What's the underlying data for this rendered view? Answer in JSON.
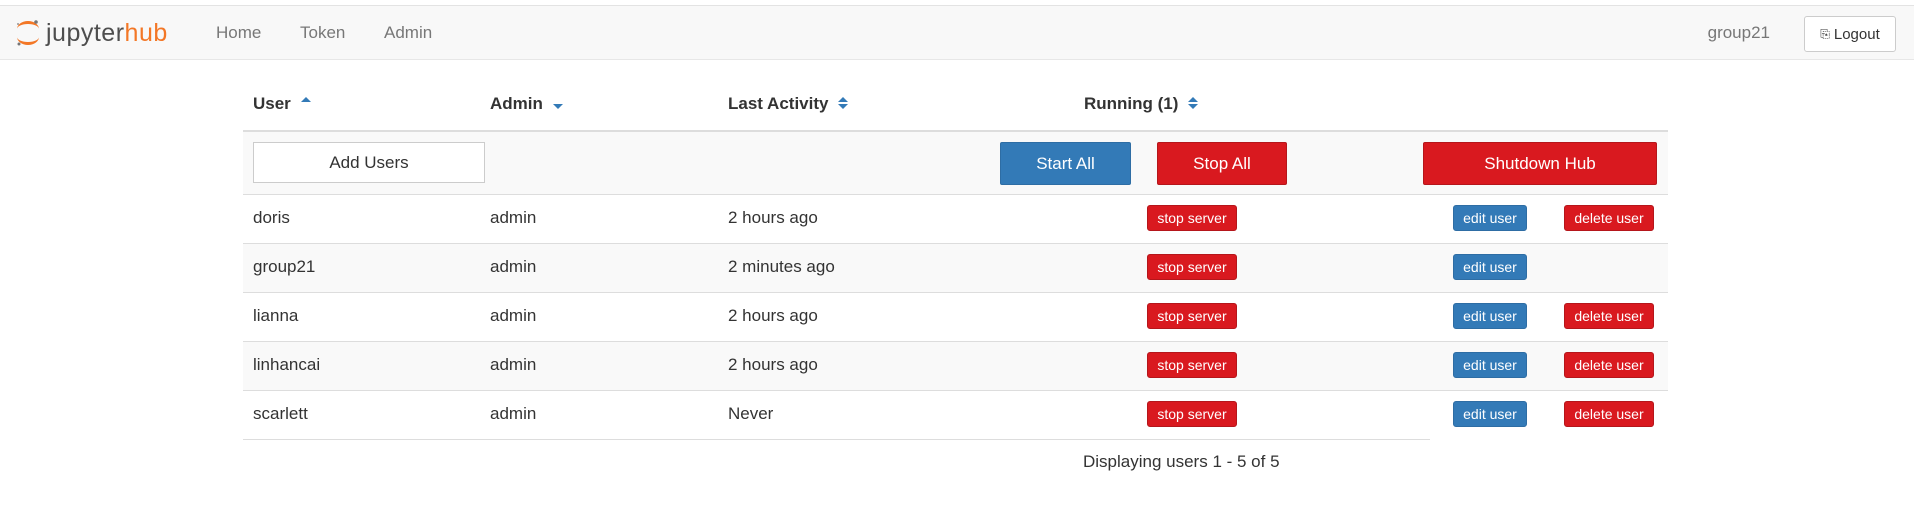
{
  "nav": {
    "brand_left": "jupyter",
    "brand_right": "hub",
    "links": [
      "Home",
      "Token",
      "Admin"
    ],
    "user": "group21",
    "logout": "Logout"
  },
  "table": {
    "headers": {
      "user": "User",
      "admin": "Admin",
      "last_activity": "Last Activity",
      "running": "Running (1)"
    },
    "actions": {
      "add_users": "Add Users",
      "start_all": "Start All",
      "stop_all": "Stop All",
      "shutdown_hub": "Shutdown Hub"
    },
    "rows": [
      {
        "name": "doris",
        "admin": "admin",
        "last": "2 hours ago",
        "stop": "stop server",
        "edit": "edit user",
        "delete": "delete user"
      },
      {
        "name": "group21",
        "admin": "admin",
        "last": "2 minutes ago",
        "stop": "stop server",
        "edit": "edit user"
      },
      {
        "name": "lianna",
        "admin": "admin",
        "last": "2 hours ago",
        "stop": "stop server",
        "edit": "edit user",
        "delete": "delete user"
      },
      {
        "name": "linhancai",
        "admin": "admin",
        "last": "2 hours ago",
        "stop": "stop server",
        "edit": "edit user",
        "delete": "delete user"
      },
      {
        "name": "scarlett",
        "admin": "admin",
        "last": "Never",
        "stop": "stop server",
        "edit": "edit user",
        "delete": "delete user"
      }
    ],
    "footer": "Displaying users 1 - 5 of 5"
  },
  "colors": {
    "primary": "#337ab7",
    "danger": "#d9191f",
    "brand_orange": "#f37726"
  }
}
